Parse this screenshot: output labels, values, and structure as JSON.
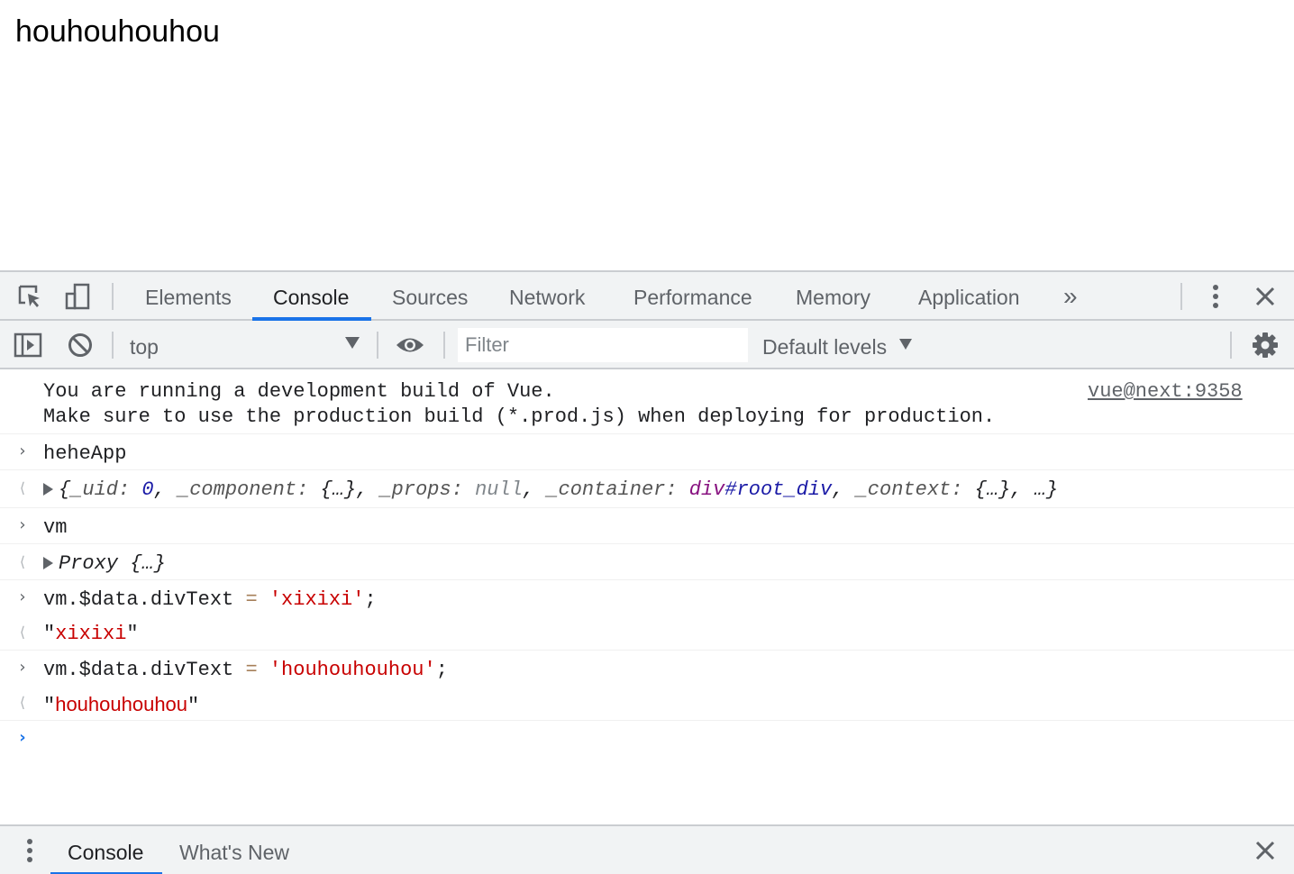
{
  "page": {
    "text": "houhouhouhou"
  },
  "devtools": {
    "icons": {
      "inspect": "inspect-element-icon",
      "device": "device-toolbar-icon",
      "more_tabs": "chevron-double-right-icon",
      "menu": "vertical-dots-icon",
      "close": "close-icon",
      "sidebar": "sidebar-toggle-icon",
      "clear": "clear-console-icon",
      "eye": "live-expression-eye-icon",
      "settings": "gear-icon"
    },
    "tabs": [
      {
        "label": "Elements"
      },
      {
        "label": "Console",
        "active": true
      },
      {
        "label": "Sources"
      },
      {
        "label": "Network"
      },
      {
        "label": "Performance"
      },
      {
        "label": "Memory"
      },
      {
        "label": "Application"
      }
    ],
    "more_tabs_glyph": "»",
    "toolbar": {
      "context": "top",
      "filter_placeholder": "Filter",
      "levels": "Default levels"
    },
    "console": {
      "warning_line1": "You are running a development build of Vue.",
      "warning_line2": "Make sure to use the production build (*.prod.js) when deploying for production.",
      "warning_source": "vue@next:9358",
      "entries": [
        {
          "input": "heheApp"
        },
        {
          "input": "vm"
        },
        {
          "input_obj": "vm.$data.divText",
          "input_eq": "=",
          "input_str": "'xixixi'",
          "input_end": ";",
          "output_str": "xixixi"
        },
        {
          "input_obj": "vm.$data.divText",
          "input_eq": "=",
          "input_str": "'houhouhouhou'",
          "input_end": ";",
          "output_str": "houhouhouhou"
        }
      ],
      "out_app": {
        "open": "{",
        "k1": "_uid",
        "v1": "0",
        "k2": "_component",
        "v2": "{…}",
        "k3": "_props",
        "v3": "null",
        "k4": "_container",
        "v4_tag": "div",
        "v4_id": "#root_div",
        "k5": "_context",
        "v5": "{…}",
        "tail": "…}",
        "colon": ": ",
        "comma": ", "
      },
      "out_vm": {
        "label": "Proxy",
        "value": "{…}"
      },
      "quote": "\""
    },
    "drawer": {
      "tabs": [
        {
          "label": "Console",
          "active": true
        },
        {
          "label": "What's New"
        }
      ]
    },
    "colors": {
      "accent": "#1a73e8",
      "string": "#c80000",
      "panel_bg": "#f1f3f4"
    }
  }
}
